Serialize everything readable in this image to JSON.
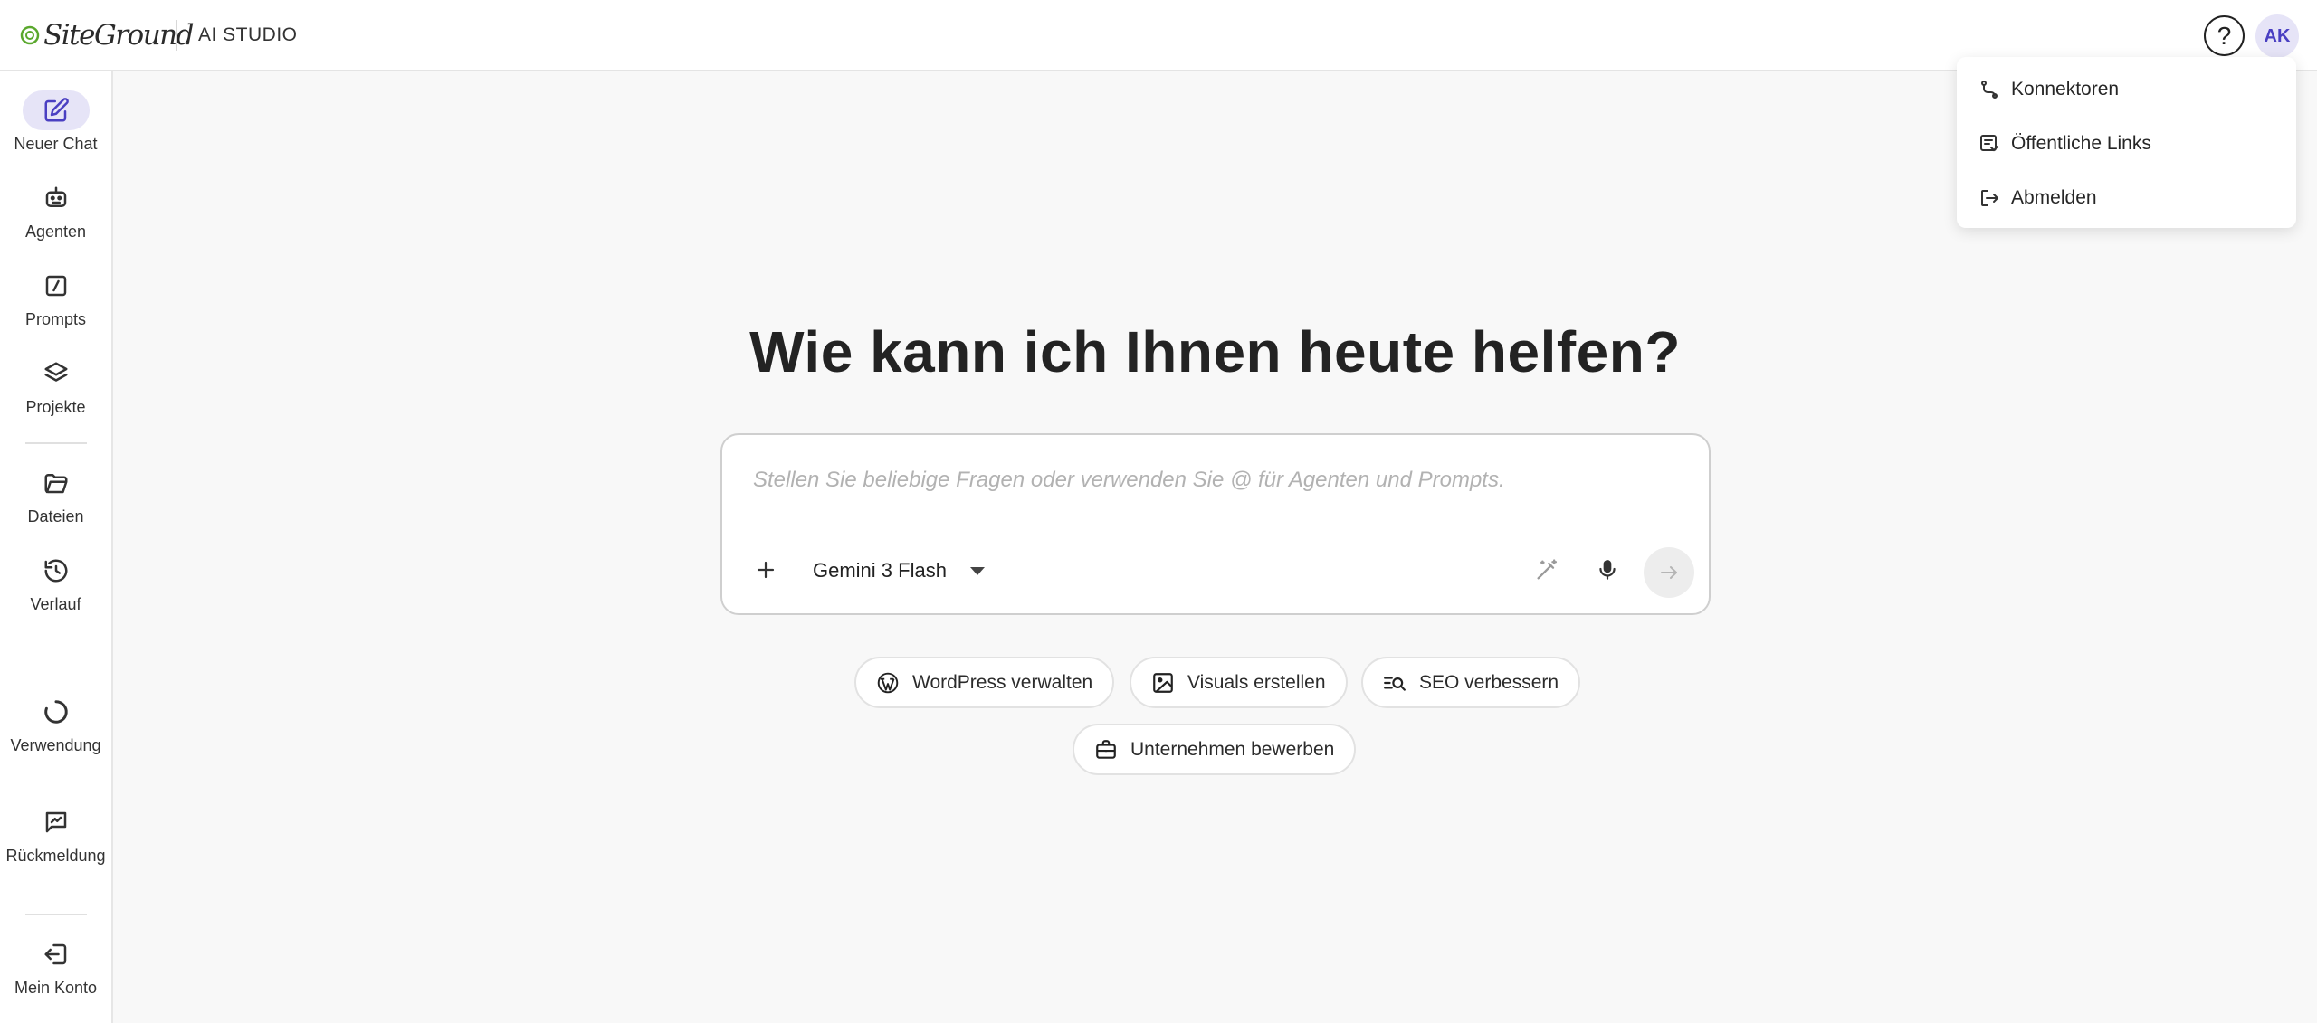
{
  "header": {
    "logo_text": "SiteGround",
    "product": "AI STUDIO",
    "help_symbol": "?",
    "avatar_initials": "AK"
  },
  "sidebar": {
    "items": [
      {
        "label": "Neuer Chat",
        "icon": "new-chat-icon",
        "active": true
      },
      {
        "label": "Agenten",
        "icon": "robot-icon"
      },
      {
        "label": "Prompts",
        "icon": "prompt-slash-icon"
      },
      {
        "label": "Projekte",
        "icon": "layers-icon"
      },
      {
        "label": "Dateien",
        "icon": "folder-icon"
      },
      {
        "label": "Verlauf",
        "icon": "history-icon"
      },
      {
        "label": "Verwendung",
        "icon": "usage-icon"
      },
      {
        "label": "Rückmeldung",
        "icon": "feedback-icon"
      },
      {
        "label": "Mein Konto",
        "icon": "account-icon"
      }
    ]
  },
  "main": {
    "headline": "Wie kann ich Ihnen heute helfen?",
    "prompt": {
      "placeholder": "Stellen Sie beliebige Fragen oder verwenden Sie @ für Agenten und Prompts.",
      "model": "Gemini 3 Flash"
    },
    "suggestions": [
      {
        "label": "WordPress verwalten",
        "icon": "wordpress-icon"
      },
      {
        "label": "Visuals erstellen",
        "icon": "image-icon"
      },
      {
        "label": "SEO verbessern",
        "icon": "seo-search-icon"
      },
      {
        "label": "Unternehmen bewerben",
        "icon": "briefcase-icon"
      }
    ]
  },
  "account_menu": {
    "items": [
      {
        "label": "Konnektoren",
        "icon": "connector-icon"
      },
      {
        "label": "Öffentliche Links",
        "icon": "public-links-icon"
      },
      {
        "label": "Abmelden",
        "icon": "logout-icon"
      }
    ]
  },
  "colors": {
    "accent": "#4a3fc2",
    "accent_bg": "#e6e4f7",
    "logo_green": "#5aa82d"
  }
}
